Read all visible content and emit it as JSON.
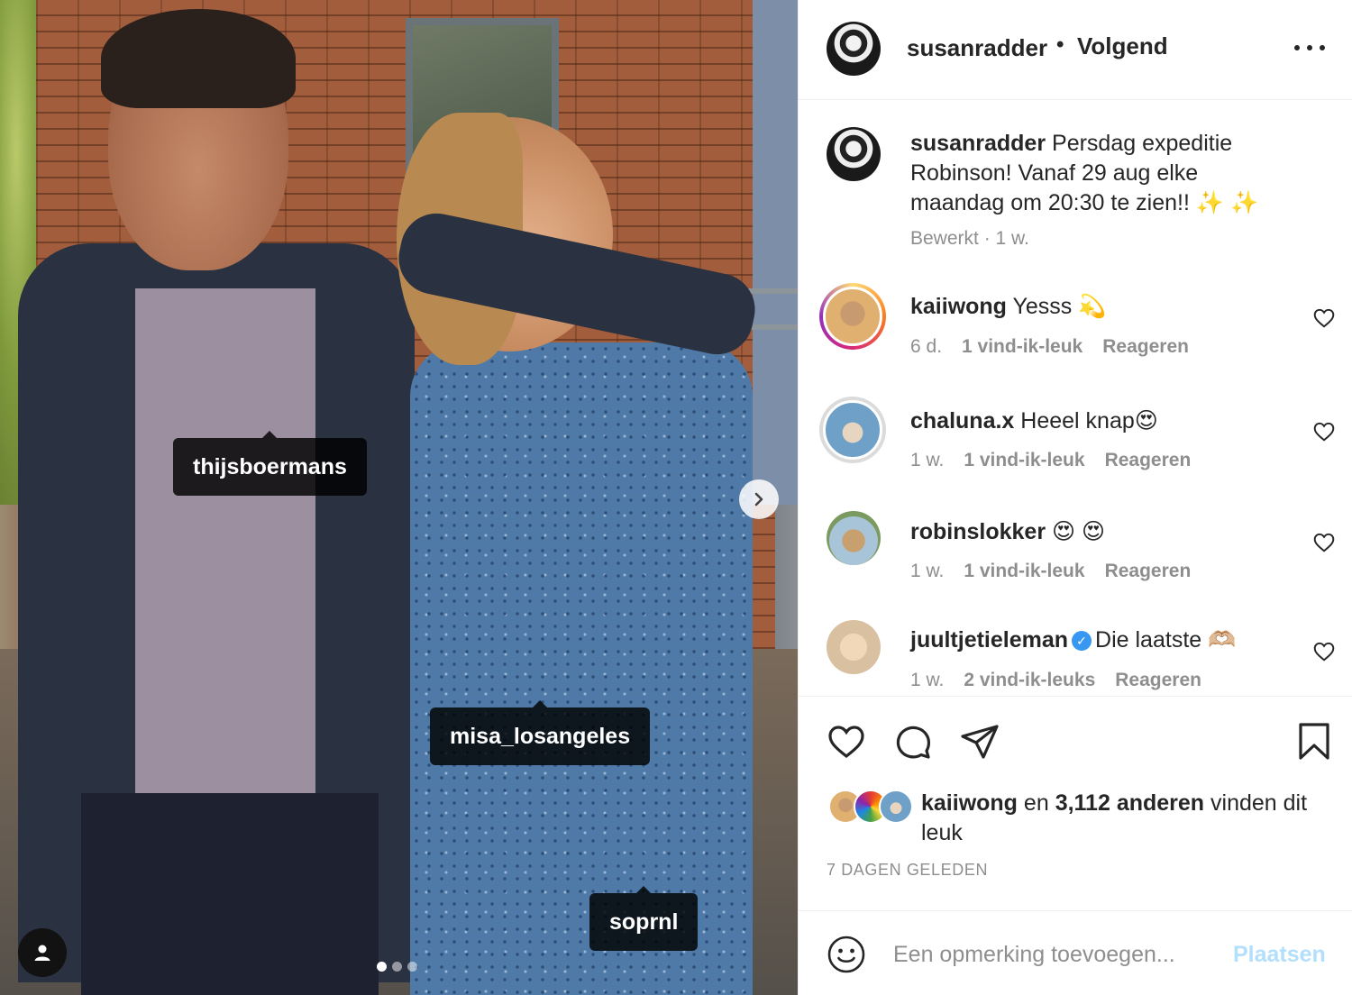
{
  "photo": {
    "tags": [
      "thijsboermans",
      "misa_losangeles",
      "soprnl"
    ],
    "carousel": {
      "count": 3,
      "active": 0
    }
  },
  "header": {
    "username": "susanradder",
    "separator": "•",
    "follow_label": "Volgend"
  },
  "caption": {
    "username": "susanradder",
    "text": "Persdag expeditie Robinson! Vanaf 29 aug elke maandag om 20:30 te zien!! ✨ ✨",
    "meta": "Bewerkt · 1 w."
  },
  "comments": [
    {
      "username": "kaiiwong",
      "text": "Yesss 💫",
      "time": "6 d.",
      "likes": "1 vind-ik-leuk",
      "reply": "Reageren",
      "verified": false
    },
    {
      "username": "chaluna.x",
      "text": "Heeel knap😍",
      "time": "1 w.",
      "likes": "1 vind-ik-leuk",
      "reply": "Reageren",
      "verified": false
    },
    {
      "username": "robinslokker",
      "text": "😍 😍",
      "time": "1 w.",
      "likes": "1 vind-ik-leuk",
      "reply": "Reageren",
      "verified": false
    },
    {
      "username": "juultjetieleman",
      "text": "Die laatste 🫶🏼",
      "time": "1 w.",
      "likes": "2 vind-ik-leuks",
      "reply": "Reageren",
      "verified": true
    }
  ],
  "likes": {
    "first_user": "kaiiwong",
    "connector": "en",
    "others": "3,112 anderen",
    "suffix": "vinden dit leuk"
  },
  "timestamp": "7 DAGEN GELEDEN",
  "add_comment": {
    "placeholder": "Een opmerking toevoegen...",
    "post_label": "Plaatsen"
  },
  "colors": {
    "text": "#262626",
    "muted": "#8e8e8e",
    "post_disabled": "#b2dffc",
    "verified": "#3897f0"
  }
}
